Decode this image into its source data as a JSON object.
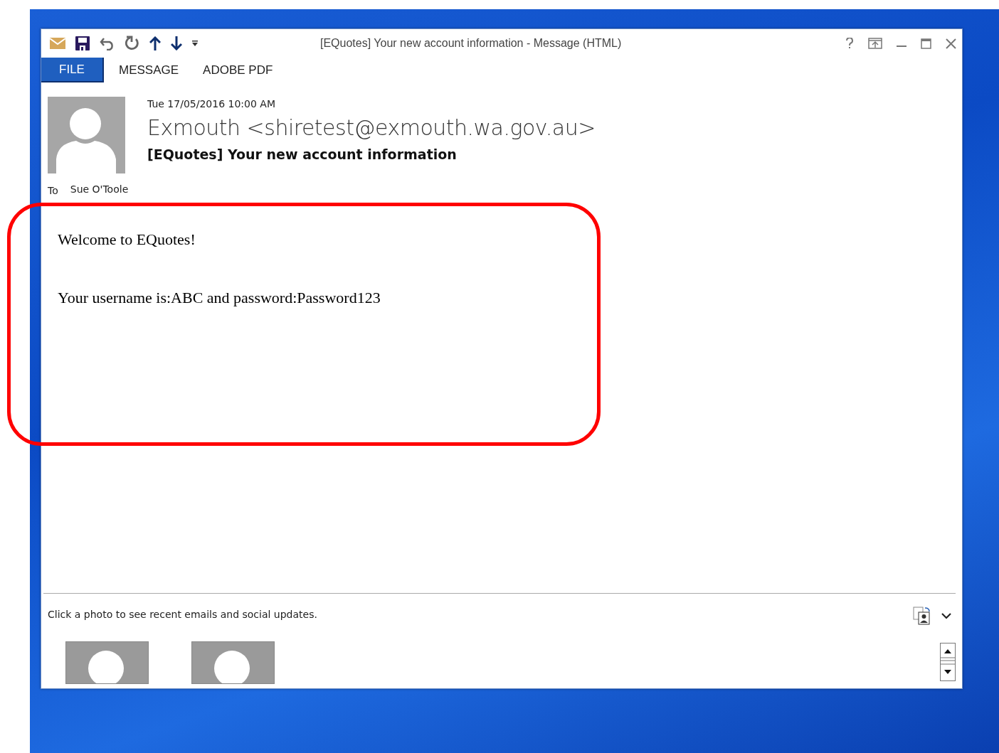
{
  "window": {
    "title": "[EQuotes] Your new account information - Message (HTML)"
  },
  "tabs": [
    {
      "label": "FILE",
      "selected": true
    },
    {
      "label": "MESSAGE",
      "selected": false
    },
    {
      "label": "ADOBE PDF",
      "selected": false
    }
  ],
  "message": {
    "date": "Tue 17/05/2016 10:00 AM",
    "from": "Exmouth <shiretest@exmouth.wa.gov.au>",
    "subject": "[EQuotes] Your new account information",
    "to_label": "To",
    "to": "Sue O'Toole",
    "body": [
      "Welcome to EQuotes!",
      "Your username is:ABC and password:Password123"
    ]
  },
  "people_pane": {
    "hint": "Click a photo to see recent emails and social updates."
  }
}
